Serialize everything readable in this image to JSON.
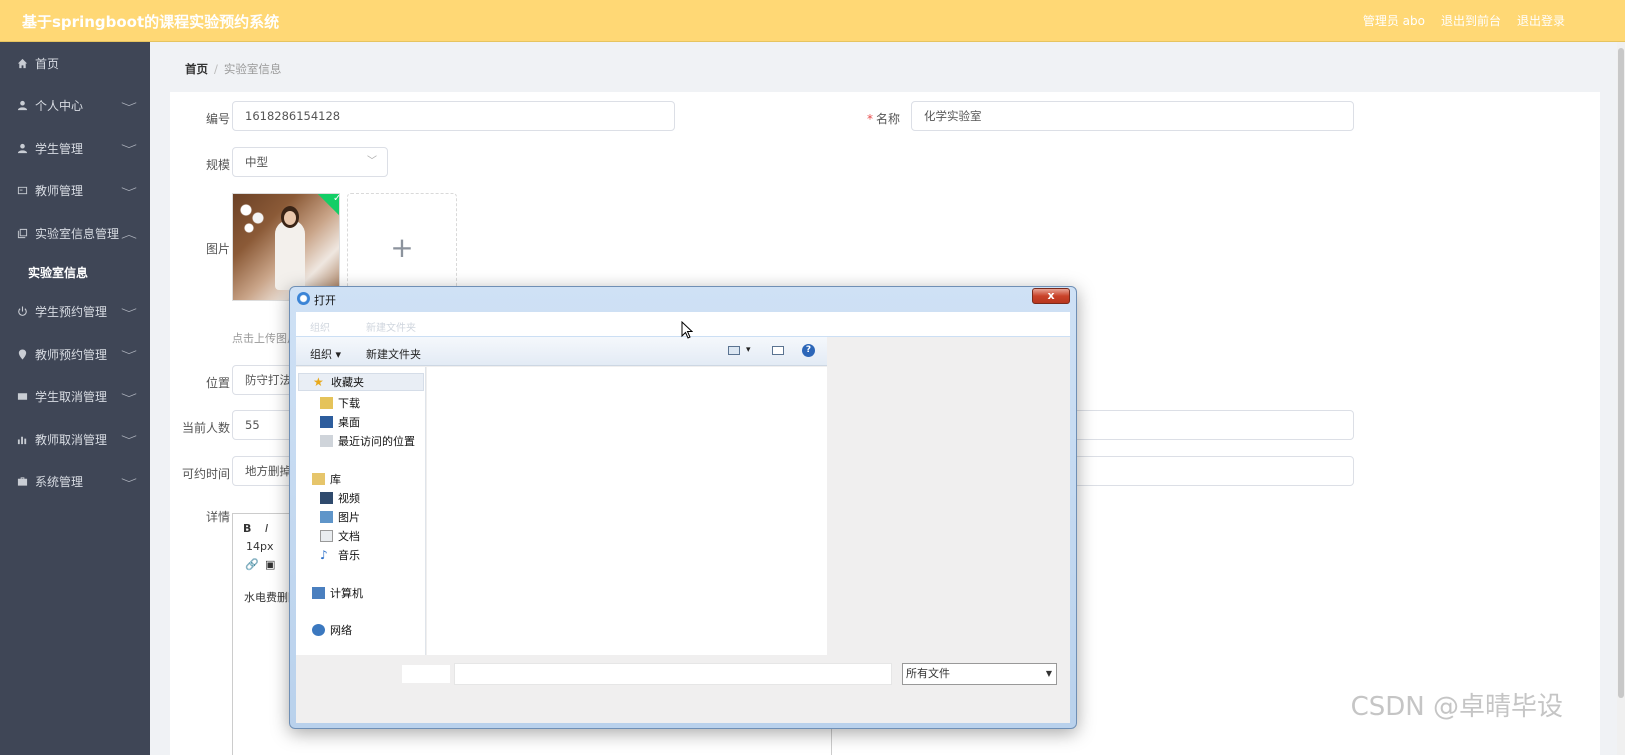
{
  "app": {
    "title": "基于springboot的课程实验预约系统"
  },
  "topbar": {
    "user": "管理员 abo",
    "frontend": "退出到前台",
    "logout": "退出登录"
  },
  "sidebar": {
    "items": [
      {
        "label": "首页",
        "icon": "home-icon"
      },
      {
        "label": "个人中心",
        "icon": "user-icon"
      },
      {
        "label": "学生管理",
        "icon": "user-icon"
      },
      {
        "label": "教师管理",
        "icon": "id-card-icon"
      },
      {
        "label": "实验室信息管理",
        "icon": "copy-icon"
      },
      {
        "label": "学生预约管理",
        "icon": "power-icon"
      },
      {
        "label": "教师预约管理",
        "icon": "location-icon"
      },
      {
        "label": "学生取消管理",
        "icon": "mail-icon"
      },
      {
        "label": "教师取消管理",
        "icon": "bar-chart-icon"
      },
      {
        "label": "系统管理",
        "icon": "briefcase-icon"
      }
    ],
    "sub_item": "实验室信息"
  },
  "breadcrumb": {
    "home": "首页",
    "separator": "/",
    "current": "实验室信息"
  },
  "form": {
    "number_label": "编号",
    "number_value": "1618286154128",
    "name_label": "名称",
    "name_required": "*",
    "name_value": "化学实验室",
    "scale_label": "规模",
    "scale_value": "中型",
    "image_label": "图片",
    "upload_plus": "+",
    "upload_hint": "点击上传图片",
    "location_label": "位置",
    "location_value": "防守打法删",
    "current_count_label": "当前人数",
    "current_count_value": "55",
    "time_label": "可约时间",
    "time_value": "地方删掉水",
    "detail_label": "详情",
    "editor_font_size": "14px",
    "editor_content": "水电费删除"
  },
  "dialog": {
    "title": "打开",
    "close": "x",
    "toolbar": {
      "organize": "组织",
      "new_folder": "新建文件夹"
    },
    "ghost_toolbar": {
      "organize": "组织",
      "new_folder": "新建文件夹"
    },
    "nav": {
      "favorites": "收藏夹",
      "downloads": "下载",
      "desktop": "桌面",
      "recent": "最近访问的位置",
      "libraries": "库",
      "videos": "视频",
      "pictures": "图片",
      "documents": "文档",
      "music": "音乐",
      "computer": "计算机",
      "network": "网络"
    },
    "file_type": "所有文件"
  },
  "watermark": "CSDN @卓晴毕设"
}
